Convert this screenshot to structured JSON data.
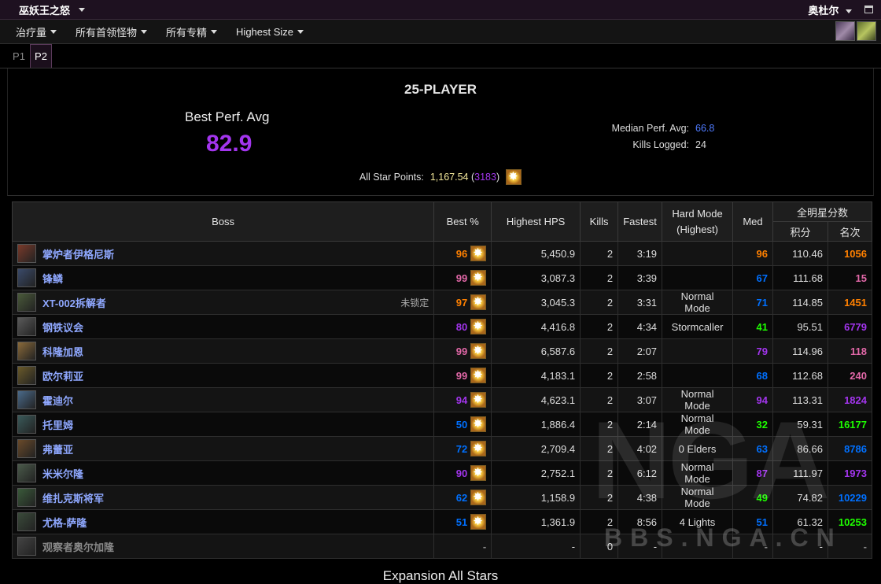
{
  "topbar": {
    "zone": "巫妖王之怒",
    "server": "奥杜尔"
  },
  "filters": [
    {
      "label": "治疗量"
    },
    {
      "label": "所有首领怪物"
    },
    {
      "label": "所有专精"
    },
    {
      "label": "Highest Size"
    }
  ],
  "tabs": [
    {
      "label": "P1"
    },
    {
      "label": "P2"
    }
  ],
  "summary": {
    "difficulty": "25-PLAYER",
    "best_label": "Best Perf. Avg",
    "best_value": "82.9",
    "median_label": "Median Perf. Avg:",
    "median_value": "66.8",
    "kills_label": "Kills Logged:",
    "kills_value": "24",
    "allstar_label": "All Star Points:",
    "allstar_points": "1,167.54",
    "allstar_rank": "3183"
  },
  "table": {
    "headers": {
      "boss": "Boss",
      "best": "Best %",
      "hps": "Highest HPS",
      "kills": "Kills",
      "fastest": "Fastest",
      "hardmode": "Hard Mode\n(Highest)",
      "med": "Med",
      "allstar": "全明星分数",
      "points": "积分",
      "rank": "名次"
    },
    "rows": [
      {
        "name": "掌炉者伊格尼斯",
        "lock": "",
        "best": "96",
        "bq": "legendary",
        "hps": "5,450.9",
        "kills": "2",
        "fastest": "3:19",
        "hm": "",
        "med": "96",
        "mq": "legendary",
        "pts": "110.46",
        "rank": "1056",
        "rq": "legendary",
        "icon": "#7a3a2a"
      },
      {
        "name": "锋鳞",
        "lock": "",
        "best": "99",
        "bq": "pink",
        "hps": "3,087.3",
        "kills": "2",
        "fastest": "3:39",
        "hm": "",
        "med": "67",
        "mq": "rare",
        "pts": "111.68",
        "rank": "15",
        "rq": "pink",
        "icon": "#3a4a6a"
      },
      {
        "name": "XT-002拆解者",
        "lock": "未锁定",
        "best": "97",
        "bq": "legendary",
        "hps": "3,045.3",
        "kills": "2",
        "fastest": "3:31",
        "hm": "Normal Mode",
        "med": "71",
        "mq": "rare",
        "pts": "114.85",
        "rank": "1451",
        "rq": "legendary",
        "icon": "#4a5a3a"
      },
      {
        "name": "钢铁议会",
        "lock": "",
        "best": "80",
        "bq": "epic",
        "hps": "4,416.8",
        "kills": "2",
        "fastest": "4:34",
        "hm": "Stormcaller",
        "med": "41",
        "mq": "uncommon",
        "pts": "95.51",
        "rank": "6779",
        "rq": "epic",
        "icon": "#5a5a5a"
      },
      {
        "name": "科隆加恩",
        "lock": "",
        "best": "99",
        "bq": "pink",
        "hps": "6,587.6",
        "kills": "2",
        "fastest": "2:07",
        "hm": "",
        "med": "79",
        "mq": "epic",
        "pts": "114.96",
        "rank": "118",
        "rq": "pink",
        "icon": "#8a6a3a"
      },
      {
        "name": "欧尔莉亚",
        "lock": "",
        "best": "99",
        "bq": "pink",
        "hps": "4,183.1",
        "kills": "2",
        "fastest": "2:58",
        "hm": "",
        "med": "68",
        "mq": "rare",
        "pts": "112.68",
        "rank": "240",
        "rq": "pink",
        "icon": "#6a5a2a"
      },
      {
        "name": "霍迪尔",
        "lock": "",
        "best": "94",
        "bq": "epic",
        "hps": "4,623.1",
        "kills": "2",
        "fastest": "3:07",
        "hm": "Normal Mode",
        "med": "94",
        "mq": "epic",
        "pts": "113.31",
        "rank": "1824",
        "rq": "epic",
        "icon": "#4a6a8a"
      },
      {
        "name": "托里姆",
        "lock": "",
        "best": "50",
        "bq": "rare",
        "hps": "1,886.4",
        "kills": "2",
        "fastest": "2:14",
        "hm": "Normal Mode",
        "med": "32",
        "mq": "uncommon",
        "pts": "59.31",
        "rank": "16177",
        "rq": "uncommon",
        "icon": "#3a5a5a"
      },
      {
        "name": "弗蕾亚",
        "lock": "",
        "best": "72",
        "bq": "rare",
        "hps": "2,709.4",
        "kills": "2",
        "fastest": "4:02",
        "hm": "0 Elders",
        "med": "63",
        "mq": "rare",
        "pts": "86.66",
        "rank": "8786",
        "rq": "rare",
        "icon": "#6a4a2a"
      },
      {
        "name": "米米尔隆",
        "lock": "",
        "best": "90",
        "bq": "epic",
        "hps": "2,752.1",
        "kills": "2",
        "fastest": "6:12",
        "hm": "Normal Mode",
        "med": "87",
        "mq": "epic",
        "pts": "111.97",
        "rank": "1973",
        "rq": "epic",
        "icon": "#4a5a4a"
      },
      {
        "name": "维扎克斯将军",
        "lock": "",
        "best": "62",
        "bq": "rare",
        "hps": "1,158.9",
        "kills": "2",
        "fastest": "4:38",
        "hm": "Normal Mode",
        "med": "49",
        "mq": "uncommon",
        "pts": "74.82",
        "rank": "10229",
        "rq": "rare",
        "icon": "#3a5a3a"
      },
      {
        "name": "尤格-萨隆",
        "lock": "",
        "best": "51",
        "bq": "rare",
        "hps": "1,361.9",
        "kills": "2",
        "fastest": "8:56",
        "hm": "4 Lights",
        "med": "51",
        "mq": "rare",
        "pts": "61.32",
        "rank": "10253",
        "rq": "uncommon",
        "icon": "#3a4a3a"
      },
      {
        "name": "观察者奥尔加隆",
        "lock": "",
        "best": "-",
        "bq": "gray",
        "hps": "-",
        "kills": "0",
        "fastest": "-",
        "hm": "",
        "med": "-",
        "mq": "gray",
        "pts": "-",
        "rank": "-",
        "rq": "gray",
        "icon": "#444",
        "dim": true
      }
    ]
  },
  "bottom": {
    "title": "Expansion All Stars"
  },
  "watermark": {
    "logo": "NGA",
    "url": "BBS.NGA.CN"
  }
}
